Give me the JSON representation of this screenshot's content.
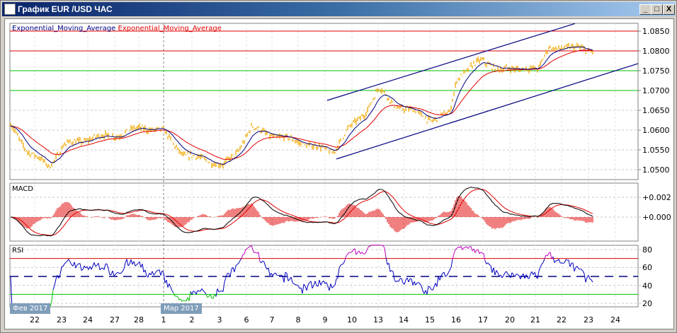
{
  "window": {
    "title": "График EUR /USD  ЧАС",
    "minimize": "_",
    "maximize": "□",
    "close": "X"
  },
  "legend": {
    "ema_fast": "Exponential_Moving_Average",
    "ema_slow": "Exponential_Moving_Average"
  },
  "panels": {
    "macd": "MACD",
    "rsi": "RSI"
  },
  "colors": {
    "bars": "#f0a800",
    "ema_fast": "#000080",
    "ema_slow": "#e00000",
    "resistance": "#e00000",
    "support": "#00c000",
    "channel": "#000080",
    "rsi_line": "#0000c0",
    "rsi_over": "#c000c0",
    "rsi_under": "#00c000"
  },
  "chart_data": {
    "type": "line",
    "price_axis": {
      "ticks": [
        "1.0850",
        "1.0800",
        "1.0750",
        "1.0700",
        "1.0650",
        "1.0600",
        "1.0550",
        "1.0500"
      ],
      "range": [
        1.0485,
        1.087
      ]
    },
    "macd_axis": {
      "ticks": [
        "+0.002",
        "+0.000"
      ]
    },
    "rsi_axis": {
      "ticks": [
        "80",
        "60",
        "40",
        "20"
      ],
      "levels": [
        70,
        50,
        30
      ]
    },
    "x_ticks": [
      "22",
      "23",
      "24",
      "27",
      "28",
      "1",
      "2",
      "3",
      "6",
      "7",
      "8",
      "9",
      "10",
      "13",
      "14",
      "15",
      "16",
      "17",
      "20",
      "21",
      "22",
      "23",
      "24"
    ],
    "months": [
      "Фев 2017",
      "Мар 2017"
    ],
    "horizontal_levels": {
      "red": [
        1.085,
        1.08
      ],
      "green": [
        1.075,
        1.07
      ]
    },
    "channel": {
      "upper": [
        [
          11.04,
          1.0675
        ],
        [
          20.4,
          1.0869
        ]
      ],
      "lower": [
        [
          11.39,
          1.0527
        ],
        [
          22.78,
          1.0768
        ]
      ]
    },
    "close_path_t_price": [
      [
        -0.94,
        1.0616
      ],
      [
        -0.24,
        1.0545
      ],
      [
        0.56,
        1.0509
      ],
      [
        1.1,
        1.0562
      ],
      [
        2.17,
        1.058
      ],
      [
        3.24,
        1.0589
      ],
      [
        4.04,
        1.0607
      ],
      [
        4.84,
        1.0598
      ],
      [
        5.64,
        1.0536
      ],
      [
        6.44,
        1.0527
      ],
      [
        7.11,
        1.0509
      ],
      [
        7.65,
        1.0545
      ],
      [
        8.18,
        1.0607
      ],
      [
        8.85,
        1.0589
      ],
      [
        9.92,
        1.0571
      ],
      [
        11.26,
        1.0545
      ],
      [
        11.79,
        1.0598
      ],
      [
        12.46,
        1.0643
      ],
      [
        13.0,
        1.0705
      ],
      [
        13.66,
        1.066
      ],
      [
        14.47,
        1.0643
      ],
      [
        15.0,
        1.0625
      ],
      [
        15.67,
        1.0643
      ],
      [
        15.94,
        1.0732
      ],
      [
        16.87,
        1.0777
      ],
      [
        17.67,
        1.075
      ],
      [
        18.47,
        1.0759
      ],
      [
        19.01,
        1.075
      ],
      [
        19.41,
        1.0812
      ],
      [
        20.08,
        1.0804
      ],
      [
        20.61,
        1.0812
      ],
      [
        21.1,
        1.0795
      ]
    ]
  }
}
